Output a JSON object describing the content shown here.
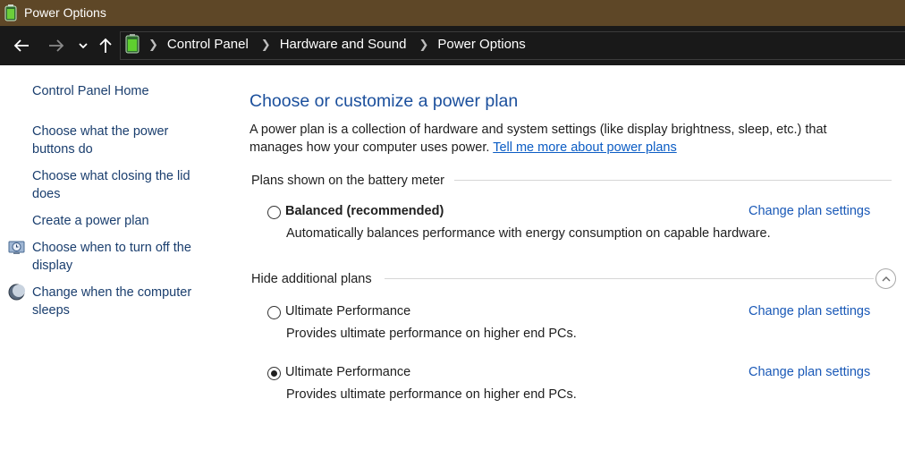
{
  "window": {
    "title": "Power Options",
    "titlebar_color": "#5e4727"
  },
  "address_bar": {
    "breadcrumbs": [
      "Control Panel",
      "Hardware and Sound",
      "Power Options"
    ],
    "icons": [
      "back-arrow-icon",
      "forward-arrow-icon",
      "recent-locations-chevron-icon",
      "up-arrow-icon",
      "power-options-battery-icon",
      "breadcrumb-separator-icon"
    ]
  },
  "sidebar": {
    "home_link": "Control Panel Home",
    "links": [
      {
        "label_line1": "Choose what the power",
        "label_line2": "buttons do",
        "icon": null
      },
      {
        "label_line1": "Choose what closing the lid",
        "label_line2": "does",
        "icon": null
      },
      {
        "label_line1": "Create a power plan",
        "label_line2": "",
        "icon": null
      },
      {
        "label_line1": "Choose when to turn off the",
        "label_line2": "display",
        "icon": "display-timer-icon"
      },
      {
        "label_line1": "Change when the computer",
        "label_line2": "sleeps",
        "icon": "sleep-moon-icon"
      }
    ]
  },
  "main": {
    "title": "Choose or customize a power plan",
    "description_line1": "A power plan is a collection of hardware and system settings (like display brightness, sleep, etc.) that",
    "description_line2": "manages how your computer uses power.",
    "learn_more_link": "Tell me more about power plans",
    "battery_group": {
      "header": "Plans shown on the battery meter",
      "plans": [
        {
          "name": "Balanced (recommended)",
          "description": "Automatically balances performance with energy consumption on capable hardware.",
          "selected": false,
          "change_link": "Change plan settings"
        }
      ]
    },
    "additional_group": {
      "header": "Hide additional plans",
      "collapse_icon": "chevron-up-circle-icon",
      "plans": [
        {
          "name": "Ultimate Performance",
          "description": "Provides ultimate performance on higher end PCs.",
          "selected": false,
          "change_link": "Change plan settings"
        },
        {
          "name": "Ultimate Performance",
          "description": "Provides ultimate performance on higher end PCs.",
          "selected": true,
          "change_link": "Change plan settings"
        }
      ]
    }
  },
  "colors": {
    "link": "#1a59b7",
    "sidebar_link": "#1a3e6e",
    "title": "#1b4f9c",
    "address_bar_bg": "#191919"
  }
}
